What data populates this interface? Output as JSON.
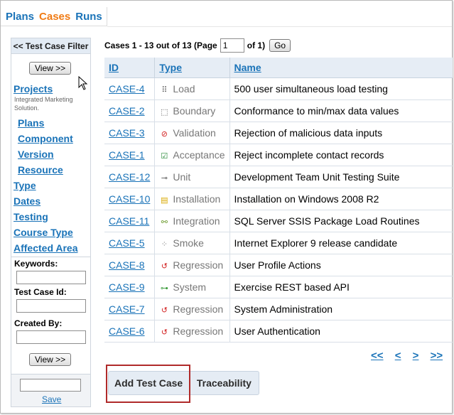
{
  "nav": {
    "tabs": [
      {
        "label": "Plans",
        "active": false
      },
      {
        "label": "Cases",
        "active": true
      },
      {
        "label": "Runs",
        "active": false
      }
    ]
  },
  "sidebar": {
    "header": "<< Test Case Filter",
    "view_label": "View >>",
    "projects_label": "Projects",
    "project_name": "Integrated Marketing Solution.",
    "sub_links": [
      "Plans",
      "Component",
      "Version",
      "Resource"
    ],
    "links": [
      "Type",
      "Dates",
      "Testing",
      "Course Type",
      "Affected Area"
    ],
    "keywords_label": "Keywords:",
    "testcase_id_label": "Test Case Id:",
    "created_by_label": "Created By:",
    "save_label": "Save"
  },
  "cases": {
    "summary_prefix": "Cases 1 - 13 out of 13 (Page",
    "page_value": "1",
    "summary_suffix": "of 1)",
    "go_label": "Go",
    "columns": [
      "ID",
      "Type",
      "Name"
    ],
    "rows": [
      {
        "id": "CASE-4",
        "type": "Load",
        "icon": "load-icon",
        "glyph": "⠿",
        "color": "#555555",
        "name": "500 user simultaneous load testing"
      },
      {
        "id": "CASE-2",
        "type": "Boundary",
        "icon": "boundary-icon",
        "glyph": "⬚",
        "color": "#555555",
        "name": "Conformance to min/max data values"
      },
      {
        "id": "CASE-3",
        "type": "Validation",
        "icon": "no-entry-icon",
        "glyph": "⊘",
        "color": "#d22020",
        "name": "Rejection of malicious data inputs"
      },
      {
        "id": "CASE-1",
        "type": "Acceptance",
        "icon": "checkbox-icon",
        "glyph": "☑",
        "color": "#2a8a3a",
        "name": "Reject incomplete contact records"
      },
      {
        "id": "CASE-12",
        "type": "Unit",
        "icon": "unit-icon",
        "glyph": "⊸",
        "color": "#555555",
        "name": "Development Team Unit Testing Suite"
      },
      {
        "id": "CASE-10",
        "type": "Installation",
        "icon": "computer-icon",
        "glyph": "▤",
        "color": "#d8a800",
        "name": "Installation on Windows 2008 R2"
      },
      {
        "id": "CASE-11",
        "type": "Integration",
        "icon": "link-icon",
        "glyph": "⚯",
        "color": "#6a9a2a",
        "name": "SQL Server SSIS Package Load Routines"
      },
      {
        "id": "CASE-5",
        "type": "Smoke",
        "icon": "smoke-icon",
        "glyph": "⁘",
        "color": "#777777",
        "name": "Internet Explorer 9 release candidate"
      },
      {
        "id": "CASE-8",
        "type": "Regression",
        "icon": "regression-icon",
        "glyph": "↺",
        "color": "#d22020",
        "name": "User Profile Actions"
      },
      {
        "id": "CASE-9",
        "type": "System",
        "icon": "system-icon",
        "glyph": "⊶",
        "color": "#3a9a3a",
        "name": "Exercise REST based API"
      },
      {
        "id": "CASE-7",
        "type": "Regression",
        "icon": "regression-icon",
        "glyph": "↺",
        "color": "#d22020",
        "name": "System Administration"
      },
      {
        "id": "CASE-6",
        "type": "Regression",
        "icon": "regression-icon",
        "glyph": "↺",
        "color": "#d22020",
        "name": "User Authentication"
      }
    ]
  },
  "pager": {
    "first": "<<",
    "prev": "<",
    "next": ">",
    "last": ">>"
  },
  "actions": {
    "add_label": "Add Test Case",
    "separator": "|",
    "trace_label": "Traceability"
  }
}
